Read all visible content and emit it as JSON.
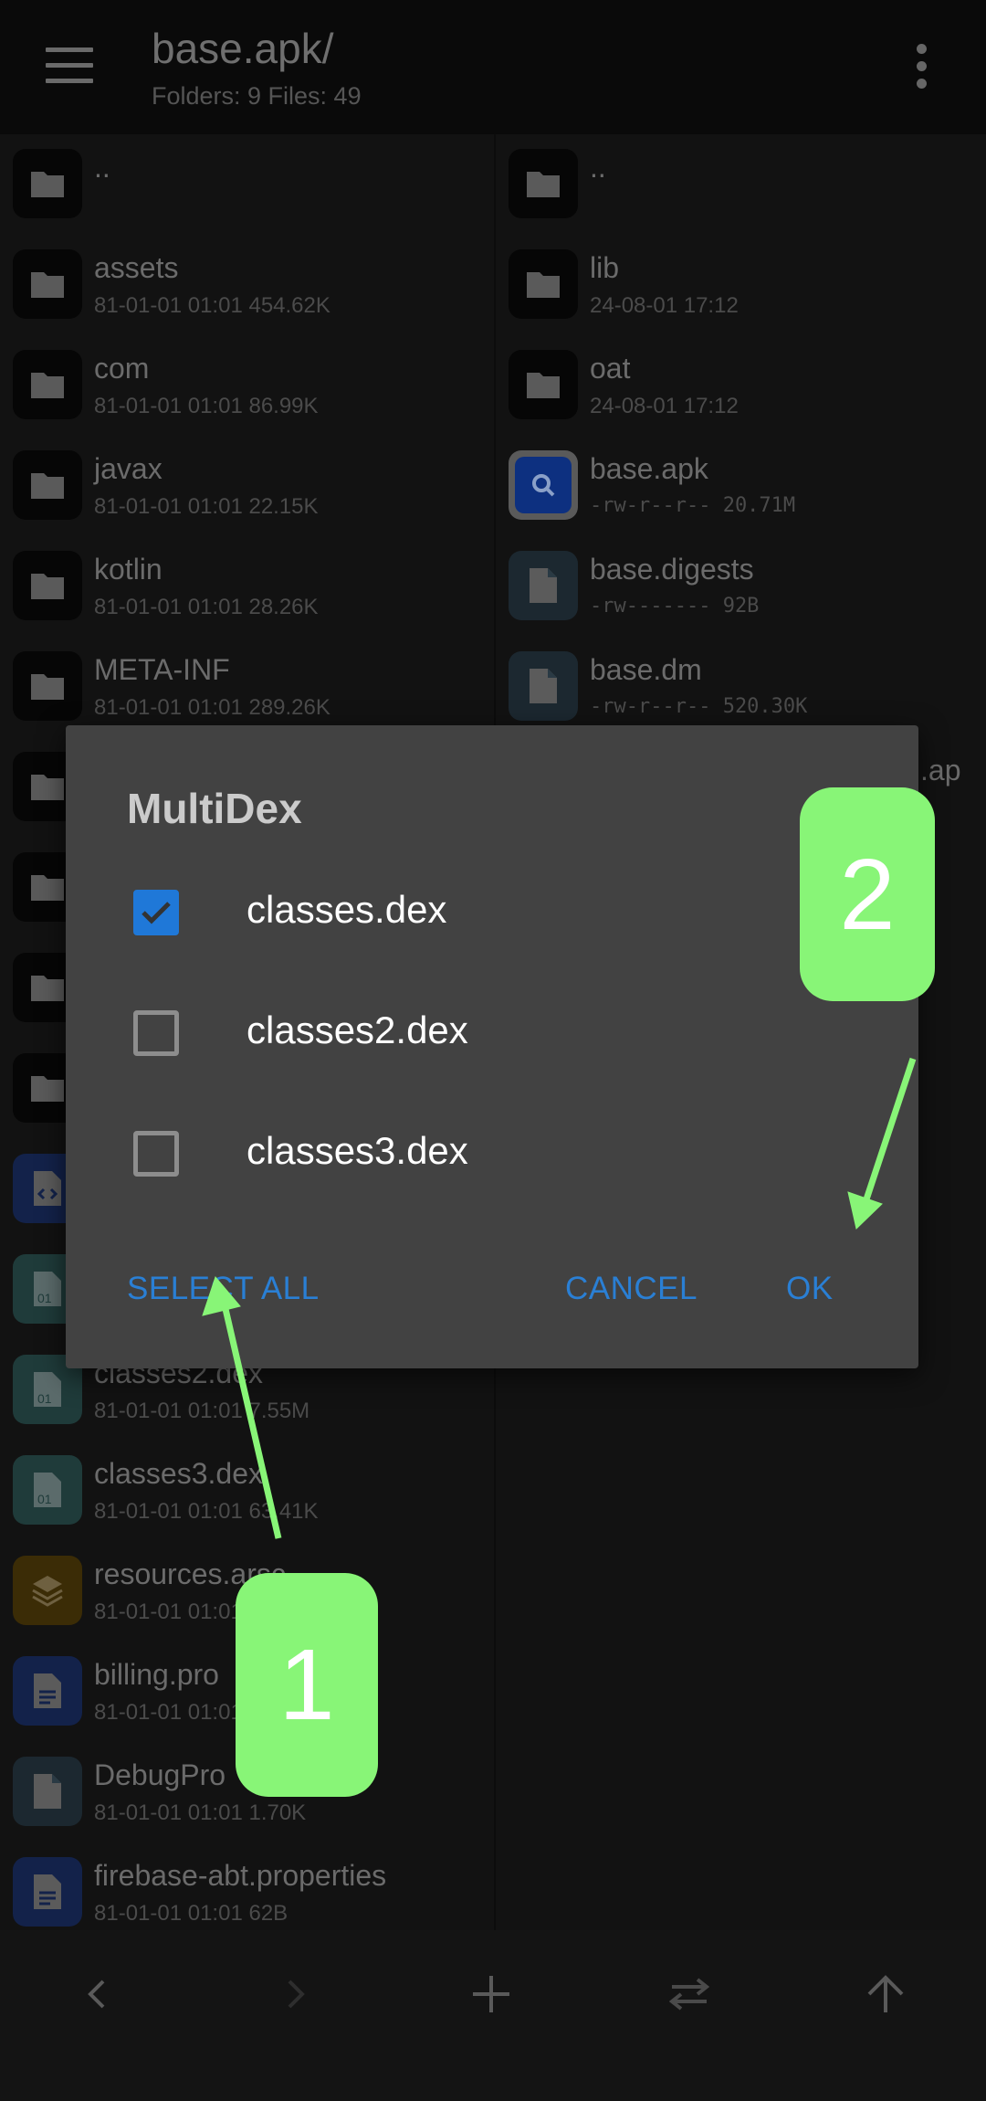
{
  "header": {
    "title": "base.apk/",
    "subtitle": "Folders: 9  Files: 49",
    "menu_icon": "hamburger-menu-icon",
    "more_icon": "more-vert-icon"
  },
  "left_pane": {
    "items": [
      {
        "name": "..",
        "meta": "",
        "icon": "folder"
      },
      {
        "name": "assets",
        "meta": "81-01-01 01:01  454.62K",
        "icon": "folder"
      },
      {
        "name": "com",
        "meta": "81-01-01 01:01  86.99K",
        "icon": "folder"
      },
      {
        "name": "javax",
        "meta": "81-01-01 01:01  22.15K",
        "icon": "folder"
      },
      {
        "name": "kotlin",
        "meta": "81-01-01 01:01  28.26K",
        "icon": "folder"
      },
      {
        "name": "META-INF",
        "meta": "81-01-01 01:01  289.26K",
        "icon": "folder"
      },
      {
        "name": "",
        "meta": "",
        "icon": "folder"
      },
      {
        "name": "",
        "meta": "",
        "icon": "folder"
      },
      {
        "name": "",
        "meta": "",
        "icon": "folder"
      },
      {
        "name": "",
        "meta": "",
        "icon": "folder"
      },
      {
        "name": "",
        "meta": "",
        "icon": "xml"
      },
      {
        "name": "",
        "meta": "",
        "icon": "dex"
      },
      {
        "name": "classes2.dex",
        "meta": "81-01-01 01:01  7.55M",
        "icon": "dex"
      },
      {
        "name": "classes3.dex",
        "meta": "81-01-01 01:01  63.41K",
        "icon": "dex"
      },
      {
        "name": "resources.arsc",
        "meta": "81-01-01 01:01",
        "icon": "arsc"
      },
      {
        "name": "billing.pro",
        "meta": "81-01-01 01:01",
        "icon": "text"
      },
      {
        "name": "DebugPro",
        "meta": "81-01-01 01:01  1.70K",
        "icon": "file"
      },
      {
        "name": "firebase-abt.properties",
        "meta": "81-01-01 01:01  62B",
        "icon": "text"
      }
    ]
  },
  "right_pane": {
    "items": [
      {
        "name": "..",
        "meta": "",
        "icon": "folder"
      },
      {
        "name": "lib",
        "meta": "24-08-01 17:12",
        "icon": "folder"
      },
      {
        "name": "oat",
        "meta": "24-08-01 17:12",
        "icon": "folder"
      },
      {
        "name": "base.apk",
        "meta": "-rw-r--r--  20.71M",
        "icon": "apk",
        "mono": true
      },
      {
        "name": "base.digests",
        "meta": "-rw-------  92B",
        "icon": "file",
        "mono": true
      },
      {
        "name": "base.dm",
        "meta": "-rw-r--r--  520.30K",
        "icon": "file",
        "mono": true
      },
      {
        "name": ".ap",
        "meta": "",
        "icon": "none",
        "offset": true
      }
    ]
  },
  "dialog": {
    "title": "MultiDex",
    "items": [
      {
        "label": "classes.dex",
        "checked": true
      },
      {
        "label": "classes2.dex",
        "checked": false
      },
      {
        "label": "classes3.dex",
        "checked": false
      }
    ],
    "select_all": "SELECT ALL",
    "cancel": "CANCEL",
    "ok": "OK"
  },
  "annotations": {
    "badge1": "1",
    "badge2": "2",
    "color": "#88f577"
  },
  "bottom_bar": {
    "icons": [
      "chevron-left-icon",
      "chevron-right-icon",
      "plus-icon",
      "swap-icon",
      "arrow-up-icon"
    ]
  },
  "colors": {
    "accent": "#2a7fd4",
    "dialog_bg": "#424242",
    "checkbox": "#1f78d8"
  }
}
